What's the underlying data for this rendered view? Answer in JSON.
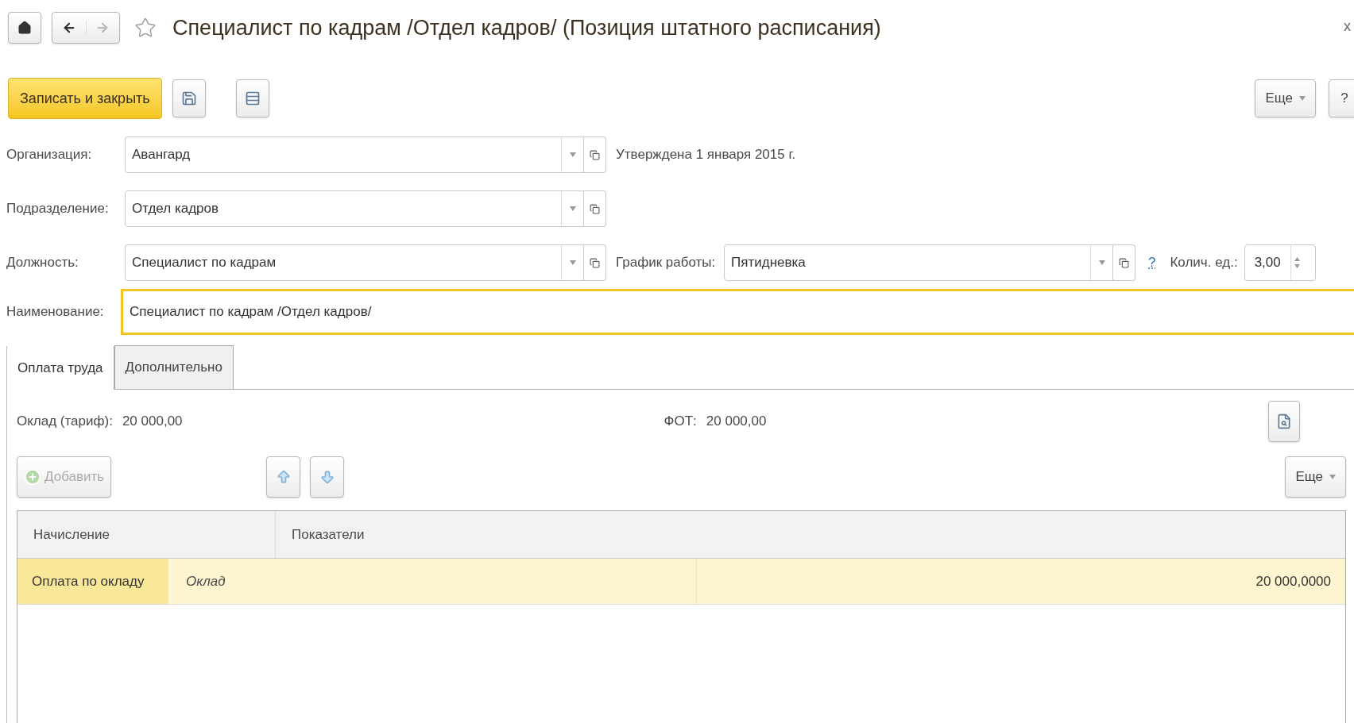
{
  "window": {
    "title": "Специалист по кадрам /Отдел кадров/ (Позиция штатного расписания)",
    "close": "x"
  },
  "toolbar": {
    "primary": "Записать и закрыть",
    "more": "Еще",
    "help": "?"
  },
  "fields": [
    {
      "label": "Организация:",
      "value": "Авангард"
    },
    {
      "label": "Подразделение:",
      "value": "Отдел кадров"
    },
    {
      "label": "Должность:",
      "value": "Специалист по кадрам"
    }
  ],
  "approval": "Утверждена 1 января 2015 г.",
  "schedule": {
    "label": "График работы:",
    "value": "Пятидневка"
  },
  "help_link": "?",
  "units": {
    "label": "Колич. ед.:",
    "value": "3,00"
  },
  "name_field": {
    "label": "Наименование:",
    "value": "Специалист по кадрам /Отдел кадров/",
    "focused": true
  },
  "tabs": [
    {
      "label": "Оплата труда",
      "selected": true
    },
    {
      "label": "Дополнительно",
      "selected": false
    }
  ],
  "salary": {
    "label": "Оклад (тариф):",
    "value": "20 000,00"
  },
  "fot": {
    "label": "ФОТ:",
    "value": "20 000,00"
  },
  "table_toolbar": {
    "add": {
      "label": "Добавить",
      "disabled": true
    },
    "more": "Еще"
  },
  "table": {
    "columns": [
      "Начисление",
      "Показатели"
    ],
    "rows": [
      {
        "accrual": "Оплата по окладу",
        "indicator": "Оклад",
        "value": "20 000,0000",
        "selected": true
      }
    ]
  }
}
